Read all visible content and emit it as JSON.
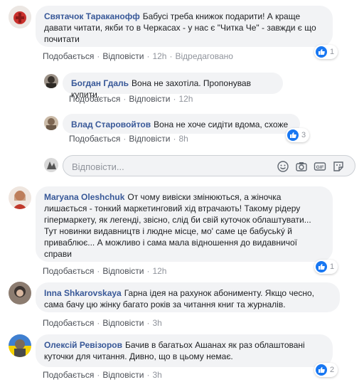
{
  "labels": {
    "like": "Подобається",
    "reply": "Відповісти",
    "edited": "Відредаговано"
  },
  "comments": [
    {
      "author": "Святачок Тараканофф",
      "text": "Бабусі треба книжок подарити! А краще давати читати, якби то в Черкасах - у нас є \"Читка Че\" - завжди є що почитати",
      "time": "12h",
      "reactions": "1",
      "avatar_color": "#c9302c"
    },
    {
      "author": "Богдан Гдаль",
      "text": "Вона не захотіла. Пропонував купити.",
      "time": "12h",
      "avatar_color": "#5a5149"
    },
    {
      "author": "Влад Старовойтов",
      "text": "Вона не хоче сидіти вдома, схоже",
      "time": "8h",
      "reactions": "3",
      "avatar_color": "#7d6652"
    },
    {
      "author": "Maryana Oleshchuk",
      "text": "От чому вивіски змінюються, а жіночка лишається - тонкий маркетинговий хід втрачають! Такому рідеру гіпермаркету, як легенді, звісно, слід би свій куточок облаштувати... Тут новинки видавництв і людне місце, мо' саме це бабусьký й приваблює... А можливо і сама мала відношення до видавничої справи",
      "time": "12h",
      "reactions": "1",
      "avatar_color": "#c98a6f"
    },
    {
      "author": "Inna Shkarovskaya",
      "text": "Гарна ідея на рахунок абонименту. Якщо чесно, сама бачу цю жінку багато років за читання книг та журналів.",
      "time": "3h",
      "avatar_color": "#3c3430"
    },
    {
      "author": "Олексій Ревізоров",
      "text": "Бачив в багатьох Ашанах як раз облаштовані куточки для читання. Дивно, що в цьому немає.",
      "time": "3h",
      "reactions": "2",
      "avatar_color": "#7aa0c8"
    }
  ],
  "reply_box": {
    "placeholder": "Відповісти..."
  },
  "colors": {
    "link": "#385898",
    "like_blue": "#1877f2",
    "bubble": "#f2f3f5"
  },
  "icons": [
    "like-icon",
    "emoji-icon",
    "camera-icon",
    "gif-icon",
    "sticker-icon"
  ]
}
